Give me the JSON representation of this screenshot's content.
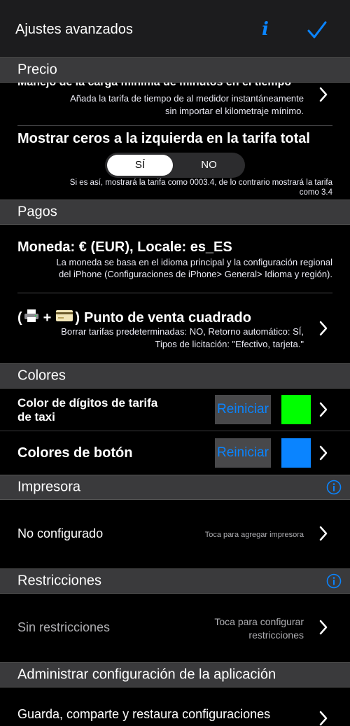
{
  "nav": {
    "title": "Ajustes avanzados"
  },
  "colors": {
    "accent": "#0a84ff",
    "taxi_digits": "#00ff00",
    "button": "#0a84ff"
  },
  "sections": {
    "precio": "Precio",
    "pagos": "Pagos",
    "colores": "Colores",
    "impresora": "Impresora",
    "restricciones": "Restricciones",
    "administrar": "Administrar configuración de la aplicación"
  },
  "precio": {
    "min_charge_title": "Manejo de la carga mínima de minutos en el tiempo",
    "min_charge_desc_1": "Añada la tarifa de tiempo de al medidor instantáneamente",
    "min_charge_desc_2": "sin importar el kilometraje mínimo.",
    "zeros_title": "Mostrar ceros a la izquierda en la tarifa total",
    "yes": "SÍ",
    "no": "NO",
    "zeros_desc_1": "Si es así, mostrará la tarifa como 0003.4, de lo contrario mostrará la tarifa",
    "zeros_desc_2": "como 3.4"
  },
  "pagos": {
    "currency_title": "Moneda: € (EUR), Locale: es_ES",
    "currency_desc_1": "La moneda se basa en el idioma principal y la configuración regional",
    "currency_desc_2": "del iPhone (Configuraciones de iPhone> General> Idioma y región).",
    "pos_title": "Punto de venta cuadrado",
    "pos_desc_1": "Borrar tarifas predeterminadas: NO, Retorno automático: SÍ,",
    "pos_desc_2": "Tipos de licitación: \"Efectivo, tarjeta.\""
  },
  "colores": {
    "digits_label_1": "Color de dígitos de tarifa",
    "digits_label_2": "de taxi",
    "button_label": "Colores de botón",
    "reset": "Reiniciar"
  },
  "impresora": {
    "status": "No configurado",
    "hint": "Toca para agregar impresora"
  },
  "restricciones": {
    "status": "Sin restricciones",
    "hint_1": "Toca para configurar",
    "hint_2": "restricciones"
  },
  "administrar": {
    "row": "Guarda, comparte y restaura configuraciones"
  }
}
